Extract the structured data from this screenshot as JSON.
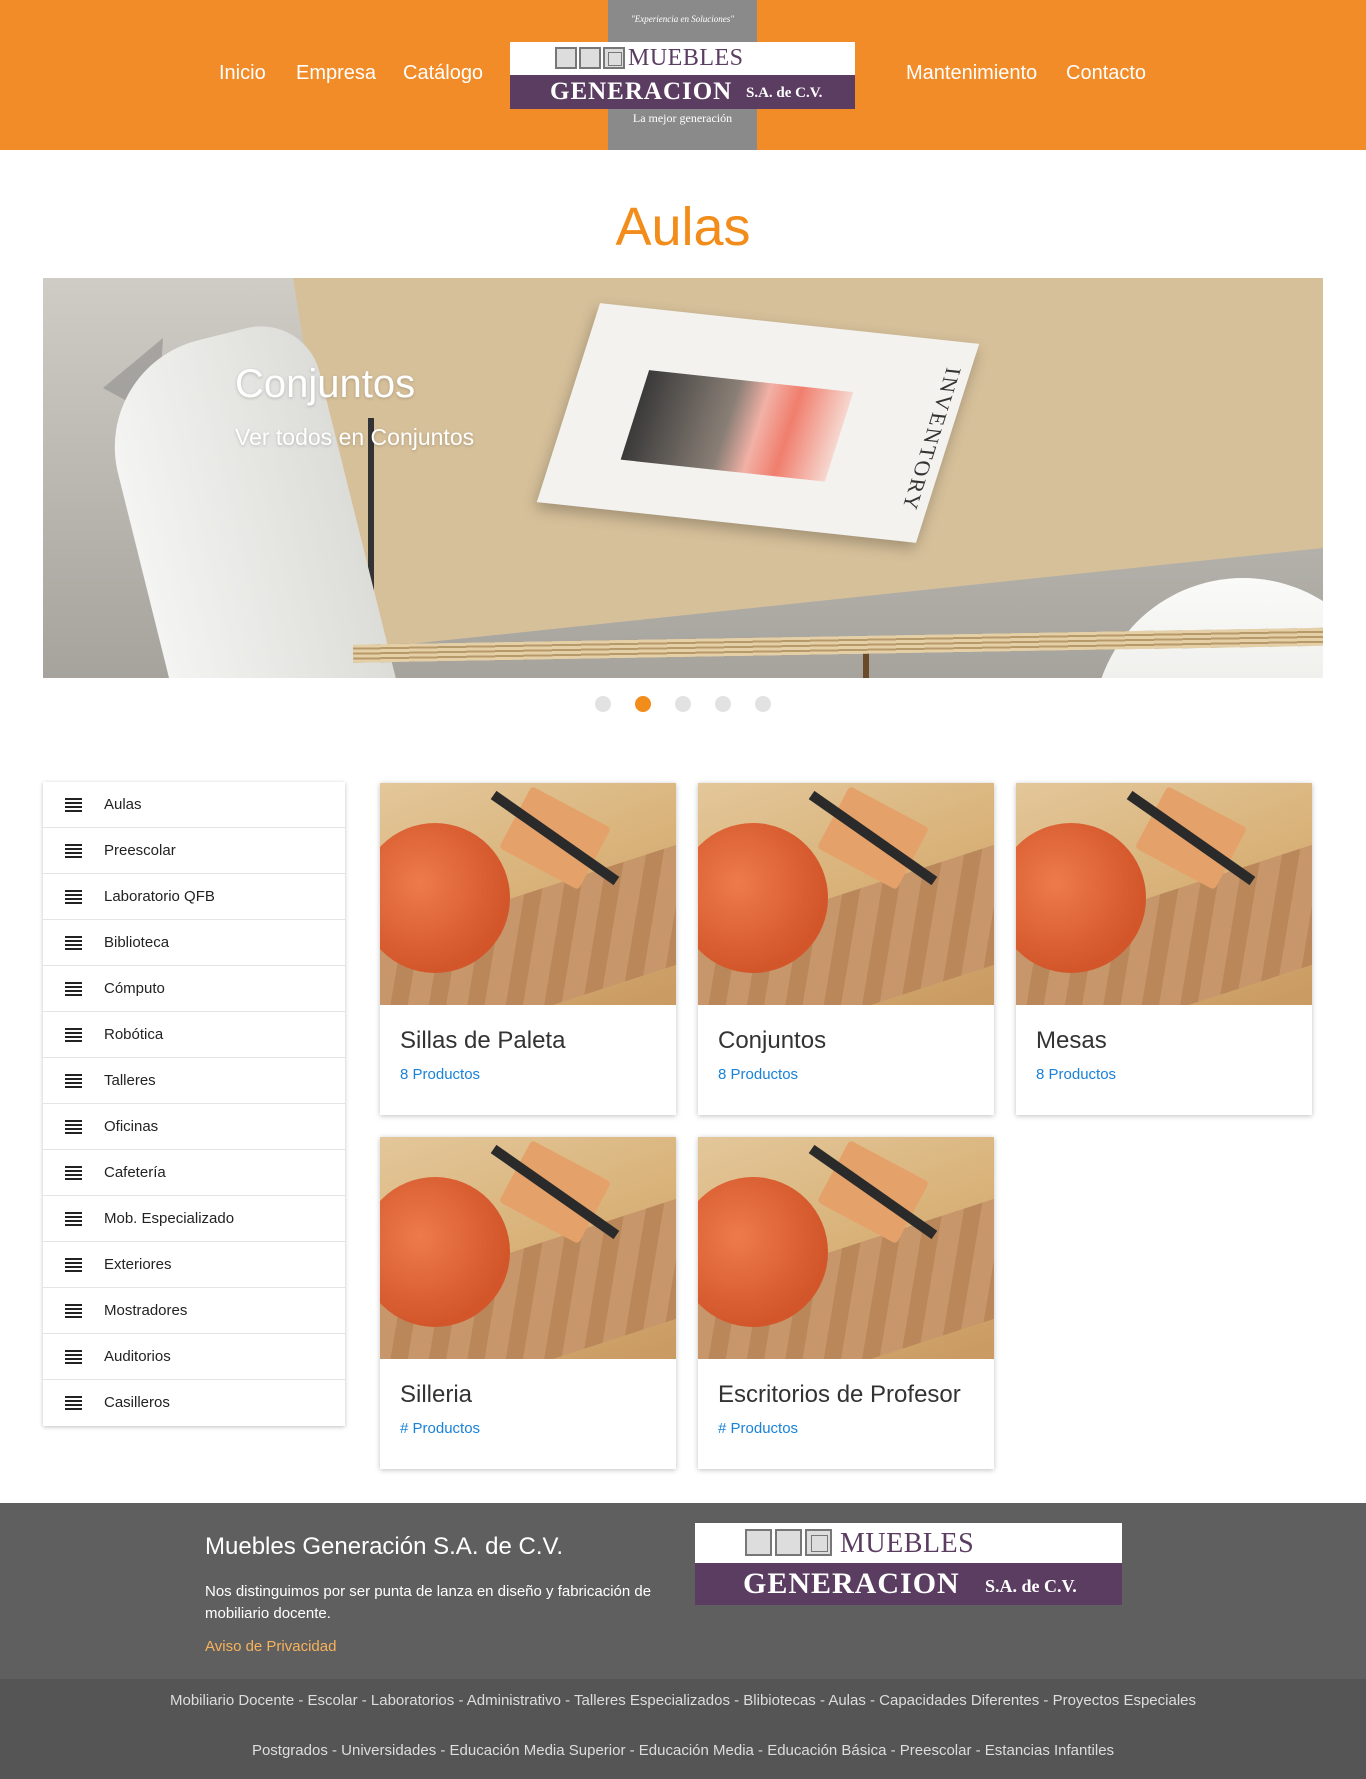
{
  "header": {
    "nav_left": [
      "Inicio",
      "Empresa",
      "Catálogo"
    ],
    "nav_right": [
      "Mantenimiento",
      "Contacto"
    ],
    "logo": {
      "tagline_top": "\"Experiencia en Soluciones\"",
      "word_top": "MUEBLES",
      "word_bottom": "GENERACION",
      "suffix": "S.A. de C.V.",
      "tagline_bottom": "La mejor generación"
    },
    "colors": {
      "bar": "#f28c28",
      "logo_band": "#8a8a8a",
      "logo_purple": "#5b3d62"
    }
  },
  "page_title": "Aulas",
  "carousel": {
    "title": "Conjuntos",
    "subtitle": "Ver todos en Conjuntos",
    "magazine_word": "INVENTORY",
    "slide_count": 5,
    "active_index": 1
  },
  "sidebar": {
    "icon": "list-icon",
    "items": [
      "Aulas",
      "Preescolar",
      "Laboratorio QFB",
      "Biblioteca",
      "Cómputo",
      "Robótica",
      "Talleres",
      "Oficinas",
      "Cafetería",
      "Mob. Especializado",
      "Exteriores",
      "Mostradores",
      "Auditorios",
      "Casilleros"
    ]
  },
  "cards": [
    {
      "title": "Sillas de Paleta",
      "count": "8 Productos"
    },
    {
      "title": "Conjuntos",
      "count": "8 Productos"
    },
    {
      "title": "Mesas",
      "count": "8 Productos"
    },
    {
      "title": "Silleria",
      "count": "# Productos"
    },
    {
      "title": "Escritorios de Profesor",
      "count": "# Productos"
    }
  ],
  "footer": {
    "title": "Muebles Generación S.A. de C.V.",
    "description": "Nos distinguimos por ser punta de lanza en diseño y fabricación de mobiliario docente.",
    "privacy_link": "Aviso de Privacidad",
    "logo": {
      "word_top": "MUEBLES",
      "word_bottom": "GENERACION",
      "suffix": "S.A. de C.V."
    },
    "links_line1": "Mobiliario Docente - Escolar - Laboratorios - Administrativo - Talleres Especializados - Blibiotecas - Aulas - Capacidades Diferentes - Proyectos Especiales",
    "links_line2": "Postgrados - Universidades - Educación Media Superior - Educación Media - Educación Básica - Preescolar - Estancias Infantiles"
  },
  "colors": {
    "accent": "#f28c1a",
    "link": "#1a82d8",
    "footer_bg": "#5f5f5f",
    "privacy": "#f7b35c"
  }
}
